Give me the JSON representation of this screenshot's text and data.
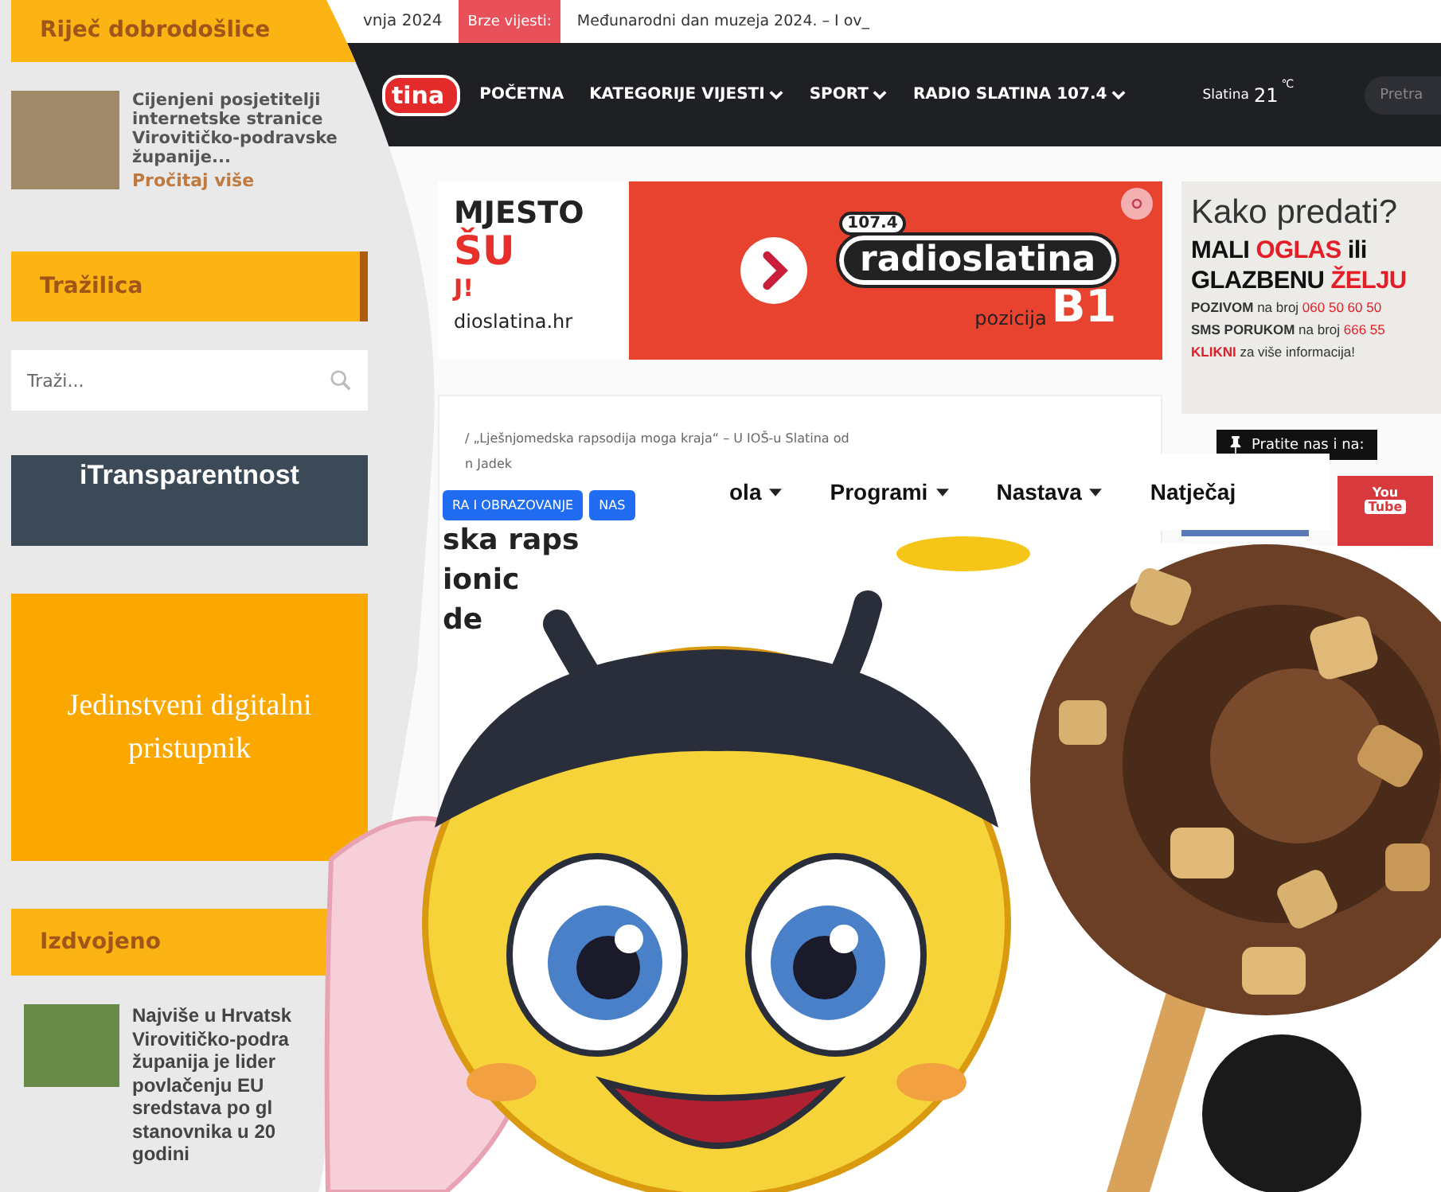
{
  "site": {
    "date": "vnja 2024",
    "breaking_label": "Brze vijesti:",
    "breaking_text": "Međunarodni dan muzeja 2024. – I ov_",
    "logo": "tina",
    "nav": [
      {
        "label": "POČETNA",
        "dropdown": false
      },
      {
        "label": "KATEGORIJE VIJESTI",
        "dropdown": true
      },
      {
        "label": "SPORT",
        "dropdown": true
      },
      {
        "label": "RADIO SLATINA 107.4",
        "dropdown": true
      }
    ],
    "weather": {
      "city": "Slatina",
      "temp": "21",
      "unit": "℃"
    },
    "search": {
      "placeholder": "Pretra"
    },
    "ad": {
      "lines": [
        "MJESTO",
        "ŠU",
        "J!",
        "dioslatina.hr"
      ],
      "frequency": "107.4",
      "brand": "radioslatina",
      "position_label": "pozicija",
      "position": "B1"
    },
    "article": {
      "breadcrumb": "/ „Lješnjomedska rapsodija moga kraja“ – U IOŠ-u Slatina od",
      "author": "n Jadek",
      "tags": [
        "RA I OBRAZOVANJE",
        "NAS"
      ],
      "title_lines": [
        "ska raps",
        "ionic",
        "de"
      ]
    },
    "side_ad": {
      "title": "Kako predati?",
      "lines": [
        [
          {
            "text": "MALI ",
            "accent": false
          },
          {
            "text": "OGLAS",
            "accent": true
          },
          {
            "text": " ili",
            "accent": false
          }
        ],
        [
          {
            "text": "GLAZBENU ",
            "accent": false
          },
          {
            "text": "ŽELJU",
            "accent": true
          }
        ]
      ],
      "call_lines": [
        [
          {
            "text": "POZIVOM",
            "accent": false
          },
          {
            "text": " na broj ",
            "accent": false
          },
          {
            "text": "060 50 60 50",
            "accent": true
          }
        ],
        [
          {
            "text": "SMS PORUKOM",
            "accent": false
          },
          {
            "text": " na broj ",
            "accent": false
          },
          {
            "text": "666 55",
            "accent": true
          }
        ],
        [
          {
            "text": "KLIKNI",
            "accent": true
          },
          {
            "text": " za više informacija!",
            "accent": false
          }
        ]
      ]
    },
    "follow": "Pratite nas i na:",
    "youtube": [
      "You",
      "Tube"
    ]
  },
  "sidebar": {
    "sections": [
      {
        "kind": "welcome",
        "heading": "Riječ dobrodošlice",
        "text": "Cijenjeni posjetitelji internetske stranice Virovitičko-podravske županije...",
        "link": "Pročitaj više"
      },
      {
        "kind": "search",
        "heading": "Tražilica",
        "placeholder": "Traži..."
      },
      {
        "kind": "banner",
        "title": "iTransparentnost"
      },
      {
        "kind": "portal",
        "text": "Jedinstveni digitalni pristupnik"
      },
      {
        "kind": "featured",
        "heading": "Izdvojeno",
        "lines": [
          "Najviše u Hrvatsk",
          "Virovitičko-podra",
          "županija je lider",
          "povlačenju EU",
          "sredstava po gl",
          "stanovnika u 20",
          "godini"
        ]
      }
    ]
  },
  "school_nav": [
    {
      "label": "ola",
      "dropdown": true
    },
    {
      "label": "Programi",
      "dropdown": true
    },
    {
      "label": "Nastava",
      "dropdown": true
    },
    {
      "label": "Natječaj",
      "dropdown": false
    }
  ]
}
